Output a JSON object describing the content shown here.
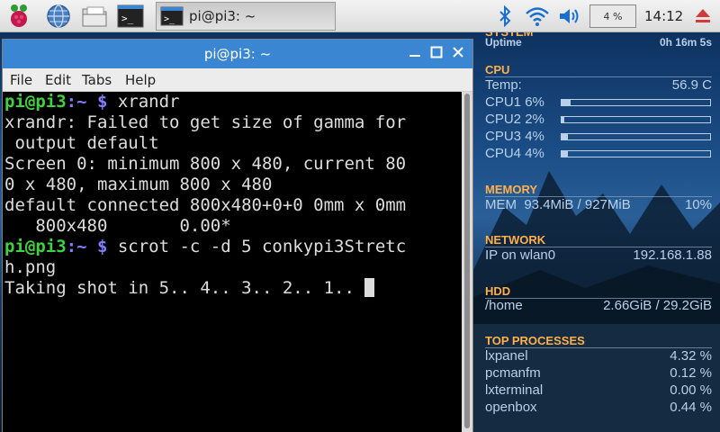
{
  "panel": {
    "task_title": "pi@pi3: ~",
    "cpu_usage": "4 %",
    "clock": "14:12"
  },
  "terminal": {
    "title": "pi@pi3: ~",
    "menu": [
      "File",
      "Edit",
      "Tabs",
      "Help"
    ],
    "user_host": "pi@pi3",
    "path": ":~ $ ",
    "cmd1": "xrandr",
    "out": [
      "xrandr: Failed to get size of gamma for",
      " output default",
      "Screen 0: minimum 800 x 480, current 80",
      "0 x 480, maximum 800 x 480",
      "default connected 800x480+0+0 0mm x 0mm",
      "   800x480       0.00*"
    ],
    "cmd2a": "scrot -c -d 5 conkypi3Stretc",
    "cmd2b": "h.png",
    "out2": "Taking shot in 5.. 4.. 3.. 2.. 1.. "
  },
  "conky": {
    "system_header": "SYSTEM",
    "uptime_label": "Uptime",
    "uptime": "0h 16m 5s",
    "cpu_header": "CPU",
    "temp_label": "Temp:",
    "temp": "56.9 C",
    "cpus": [
      {
        "label": "CPU1",
        "pct": "6%",
        "value": 0.06
      },
      {
        "label": "CPU2",
        "pct": "2%",
        "value": 0.02
      },
      {
        "label": "CPU3",
        "pct": "4%",
        "value": 0.04
      },
      {
        "label": "CPU4",
        "pct": "4%",
        "value": 0.04
      }
    ],
    "memory_header": "MEMORY",
    "mem_label": "MEM",
    "mem_used": "93.4MiB / 927MiB",
    "mem_pct": "10%",
    "network_header": "NETWORK",
    "ip_label": "IP on wlan0",
    "ip": "192.168.1.88",
    "hdd_header": "HDD",
    "hdd_mount": "/home",
    "hdd_used": "2.66GiB / 29.2GiB",
    "top_header": "TOP PROCESSES",
    "procs": [
      {
        "name": "lxpanel",
        "pct": "4.32 %"
      },
      {
        "name": "pcmanfm",
        "pct": "0.12 %"
      },
      {
        "name": "lxterminal",
        "pct": "0.00 %"
      },
      {
        "name": "openbox",
        "pct": "0.44 %"
      }
    ]
  }
}
